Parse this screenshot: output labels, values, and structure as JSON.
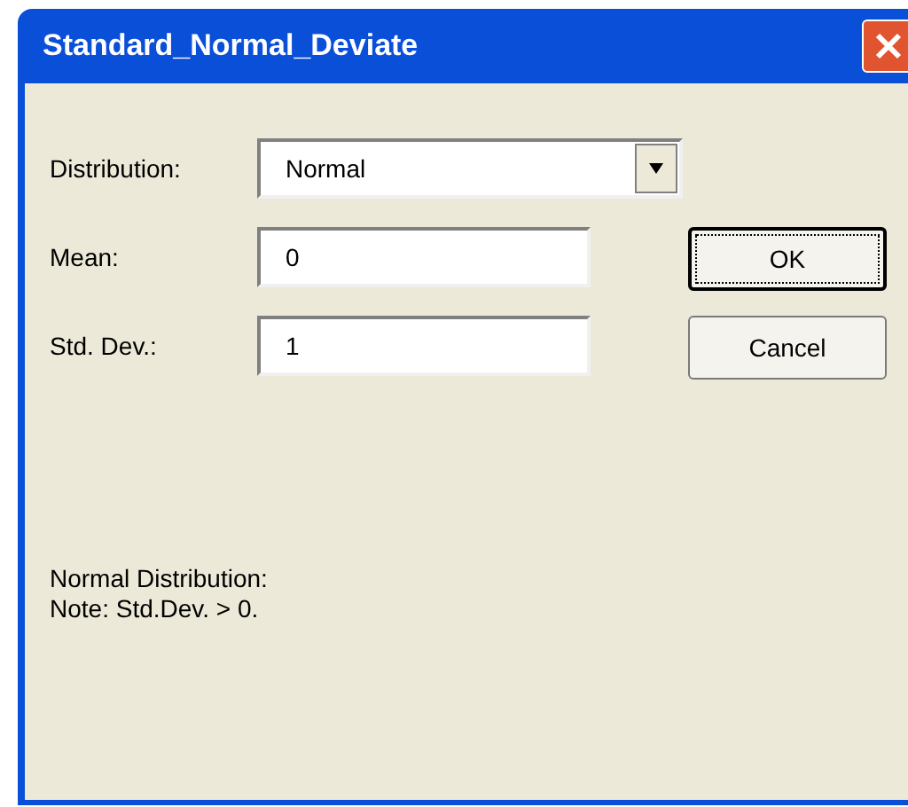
{
  "window": {
    "title": "Standard_Normal_Deviate"
  },
  "distribution": {
    "label": "Distribution:",
    "value": "Normal"
  },
  "fields": [
    {
      "label": "Mean:",
      "value": "0"
    },
    {
      "label": "Std. Dev.:",
      "value": "1"
    }
  ],
  "buttons": [
    {
      "label": "OK",
      "default": true
    },
    {
      "label": "Cancel",
      "default": false
    }
  ],
  "notes": [
    "Normal Distribution:",
    "Note: Std.Dev. > 0."
  ]
}
